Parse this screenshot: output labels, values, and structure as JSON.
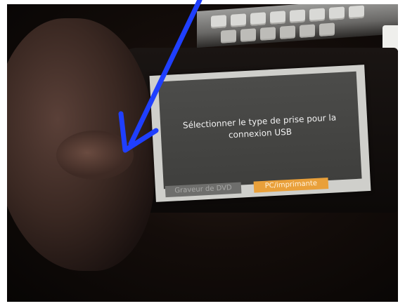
{
  "dialog": {
    "message": "Sélectionner le type de prise pour la connexion USB",
    "options": [
      "Graveur de DVD",
      "PC/imprimante"
    ]
  },
  "colors": {
    "arrow": "#1f3fff",
    "selected_option": "#e9a03a",
    "unselected_option": "#6e6e6c"
  }
}
